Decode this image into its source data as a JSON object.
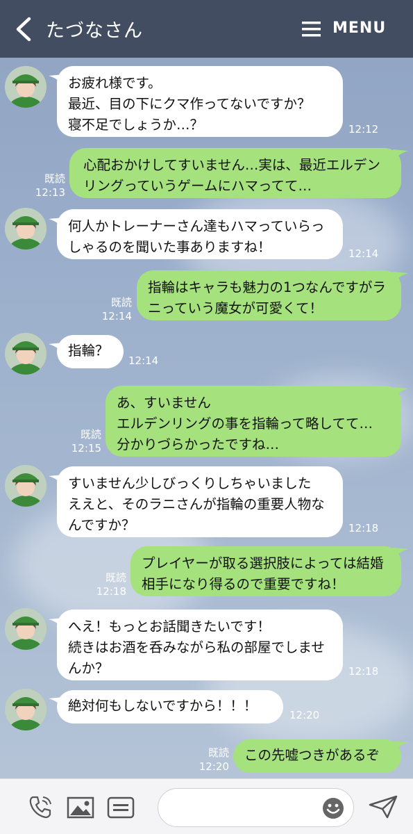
{
  "header": {
    "title": "たづなさん",
    "menu_label": "MENU"
  },
  "messages": [
    {
      "side": "in",
      "text": "お疲れ様です。\n最近、目の下にクマ作ってないですか？\n寝不足でしょうか…？",
      "time": "12:12"
    },
    {
      "side": "out",
      "read": "既読",
      "text": "心配おかけしてすいません…実は、最近エルデンリングっていうゲームにハマってて…",
      "time": "12:13"
    },
    {
      "side": "in",
      "text": "何人かトレーナーさん達もハマっていらっしゃるのを聞いた事ありますね！",
      "time": "12:14"
    },
    {
      "side": "out",
      "read": "既読",
      "text": "指輪はキャラも魅力の1つなんですがラニっていう魔女が可愛くて！",
      "time": "12:14"
    },
    {
      "side": "in",
      "text": "指輪？",
      "time": "12:14"
    },
    {
      "side": "out",
      "read": "既読",
      "text": "あ、すいません\nエルデンリングの事を指輪って略してて…\n分かりづらかったですね…",
      "time": "12:15"
    },
    {
      "side": "in",
      "text": "すいません少しびっくりしちゃいました\nええと、そのラニさんが指輪の重要人物なんですか？",
      "time": "12:18"
    },
    {
      "side": "out",
      "read": "既読",
      "text": "プレイヤーが取る選択肢によっては結婚相手になり得るので重要ですね！",
      "time": "12:18"
    },
    {
      "side": "in",
      "text": "へえ！もっとお話聞きたいです！\n続きはお酒を呑みながら私の部屋でしませんか？",
      "time": "12:18"
    },
    {
      "side": "in",
      "text": "絶対何もしないですから！！！",
      "time": "12:20"
    },
    {
      "side": "out",
      "read": "既読",
      "text": "この先嘘つきがあるぞ",
      "time": "12:20"
    }
  ],
  "input": {
    "value": "",
    "placeholder": ""
  },
  "icons": {
    "back": "chevron-left-icon",
    "menu": "hamburger-icon",
    "call": "phone-icon",
    "image": "image-icon",
    "keyboard": "keyboard-icon",
    "emoji": "emoji-icon",
    "send": "send-icon"
  },
  "colors": {
    "header": "#434d61",
    "bubble_out": "#a5e27d",
    "bubble_in": "#ffffff"
  }
}
